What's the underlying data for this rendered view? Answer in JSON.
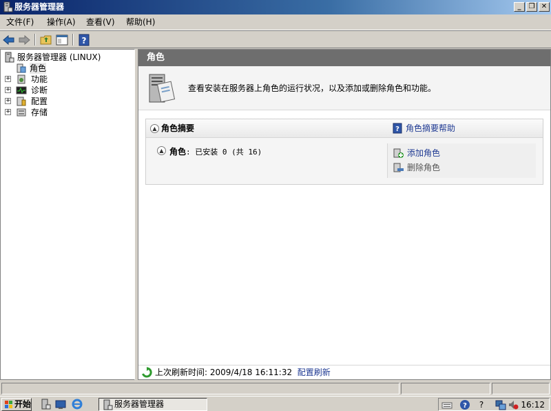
{
  "window": {
    "title": "服务器管理器",
    "minimize": "_",
    "restore": "❐",
    "close": "✕"
  },
  "menu": {
    "file": "文件(F)",
    "action": "操作(A)",
    "view": "查看(V)",
    "help": "帮助(H)"
  },
  "toolbar": {
    "icons": [
      "back-arrow-icon",
      "forward-arrow-icon",
      "up-folder-icon",
      "show-hide-console-tree-icon",
      "help-icon"
    ]
  },
  "tree": {
    "root_label": "服务器管理器 (LINUX)",
    "items": [
      {
        "label": "角色",
        "expandable": false,
        "selected": true,
        "icon": "roles-icon"
      },
      {
        "label": "功能",
        "expandable": true,
        "icon": "features-icon"
      },
      {
        "label": "诊断",
        "expandable": true,
        "icon": "diagnostics-icon"
      },
      {
        "label": "配置",
        "expandable": true,
        "icon": "configuration-icon"
      },
      {
        "label": "存储",
        "expandable": true,
        "icon": "storage-icon"
      }
    ]
  },
  "main": {
    "header": "角色",
    "intro": "查看安装在服务器上角色的运行状况，以及添加或删除角色和功能。",
    "section_title": "角色摘要",
    "help_link": "角色摘要帮助",
    "roles_label": "角色",
    "roles_status": ": 已安装 0 (共 16)",
    "add_roles": "添加角色",
    "remove_roles": "删除角色",
    "refresh_label": "上次刷新时间: 2009/4/18 16:11:32",
    "refresh_link": "配置刷新"
  },
  "taskbar": {
    "start": "开始",
    "task_label": "服务器管理器",
    "clock": "16:12"
  },
  "colors": {
    "title_bar": "#0a246a",
    "header_bar": "#6e6e6e",
    "link": "#1f3a93",
    "chrome": "#d4d0c8"
  }
}
